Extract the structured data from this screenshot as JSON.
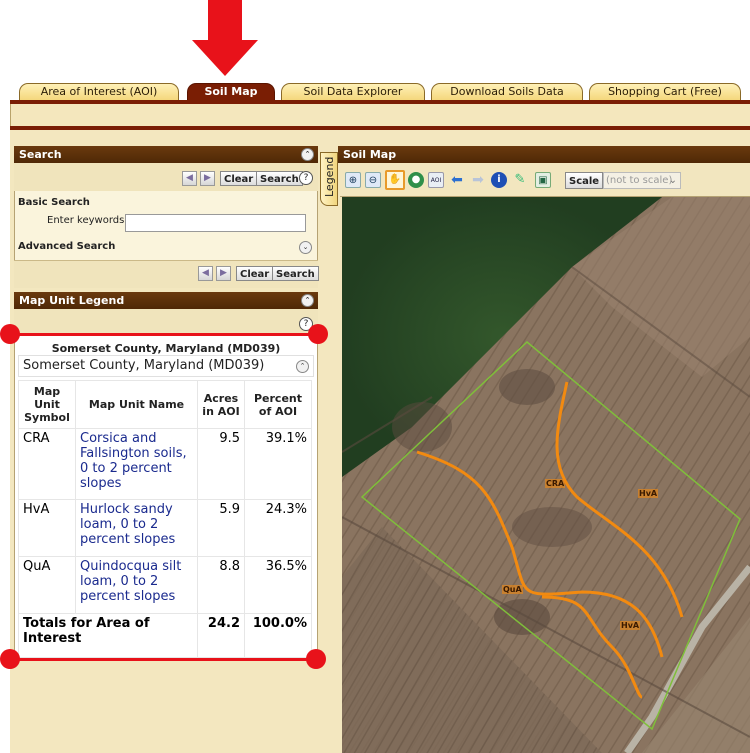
{
  "tabs": [
    {
      "label": "Area of Interest (AOI)",
      "active": false
    },
    {
      "label": "Soil Map",
      "active": true
    },
    {
      "label": "Soil Data Explorer",
      "active": false
    },
    {
      "label": "Download Soils Data",
      "active": false
    },
    {
      "label": "Shopping Cart (Free)",
      "active": false
    }
  ],
  "legend_tab": "Legend",
  "search_panel": {
    "title": "Search",
    "clear_label": "Clear",
    "search_label": "Search",
    "help_glyph": "?",
    "basic_search": "Basic Search",
    "keywords_label": "Enter keywords",
    "keywords_value": "",
    "advanced_search": "Advanced Search"
  },
  "legend_panel": {
    "title": "Map Unit Legend",
    "help_glyph": "?",
    "area_title": "Somerset County, Maryland (MD039)",
    "area_subtitle": "Somerset County, Maryland (MD039)",
    "headers": {
      "symbol": "Map Unit Symbol",
      "name": "Map Unit Name",
      "acres": "Acres in AOI",
      "percent": "Percent of AOI"
    },
    "rows": [
      {
        "symbol": "CRA",
        "name": "Corsica and Fallsington soils, 0 to 2 percent slopes",
        "acres": "9.5",
        "percent": "39.1%"
      },
      {
        "symbol": "HvA",
        "name": "Hurlock sandy loam, 0 to 2 percent slopes",
        "acres": "5.9",
        "percent": "24.3%"
      },
      {
        "symbol": "QuA",
        "name": "Quindocqua silt loam, 0 to 2 percent slopes",
        "acres": "8.8",
        "percent": "36.5%"
      }
    ],
    "total": {
      "label": "Totals for Area of Interest",
      "acres": "24.2",
      "percent": "100.0%"
    }
  },
  "soil_map": {
    "title": "Soil Map",
    "scale_label": "Scale",
    "scale_select": "(not to scale)",
    "map_labels": [
      "CRA",
      "HvA",
      "QuA",
      "HvA"
    ],
    "tools": [
      "zoom-in-icon",
      "zoom-out-icon",
      "pan-hand-icon",
      "overview-icon",
      "aoi-icon",
      "back-icon",
      "forward-icon",
      "identify-icon",
      "measure-icon",
      "print-icon"
    ]
  },
  "colors": {
    "tab_active": "#7a1e04",
    "panel_header": "#5a2e08",
    "annotation_red": "#e8121a",
    "soil_line": "#f28a10",
    "aoi_boundary": "#7fbf3a"
  }
}
